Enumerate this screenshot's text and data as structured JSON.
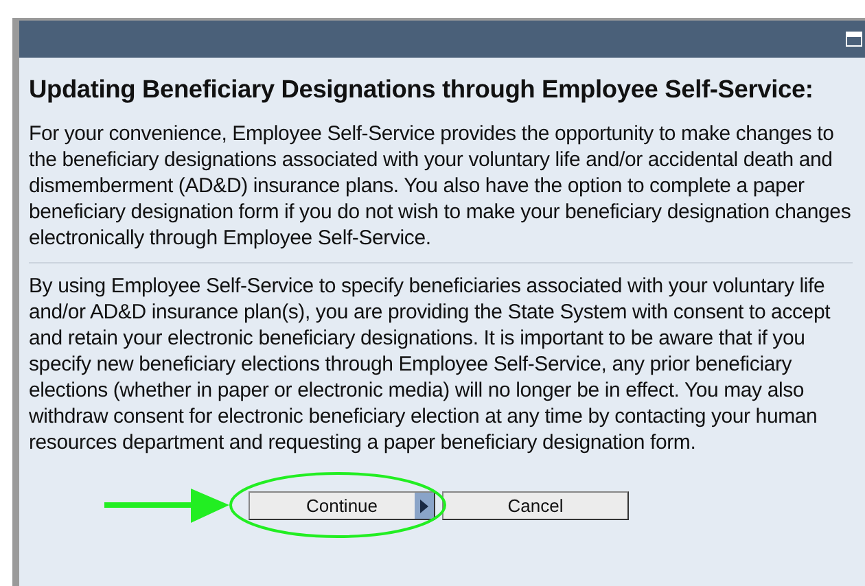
{
  "dialog": {
    "heading": "Updating Beneficiary Designations through Employee Self-Service:",
    "paragraphs": [
      "For your convenience, Employee Self-Service provides the opportunity to make changes to the beneficiary designations associated with your voluntary life and/or accidental death and dismemberment (AD&D) insurance plans.  You also have the option to complete a paper beneficiary designation form if you do not wish to make your beneficiary designation changes electronically through Employee Self-Service.",
      "By using Employee Self-Service to specify beneficiaries associated with your voluntary life and/or AD&D insurance plan(s), you are providing the State System with consent to accept and retain your electronic beneficiary designations. It is important to be aware that if you specify new beneficiary elections through Employee Self-Service, any prior beneficiary elections (whether in paper or electronic media) will no longer be in effect. You may also withdraw consent for electronic beneficiary election at any time by contacting your human resources department and requesting a paper beneficiary designation form."
    ],
    "buttons": [
      {
        "label": "Continue",
        "kind": "primary"
      },
      {
        "label": "Cancel",
        "kind": "plain"
      }
    ]
  }
}
